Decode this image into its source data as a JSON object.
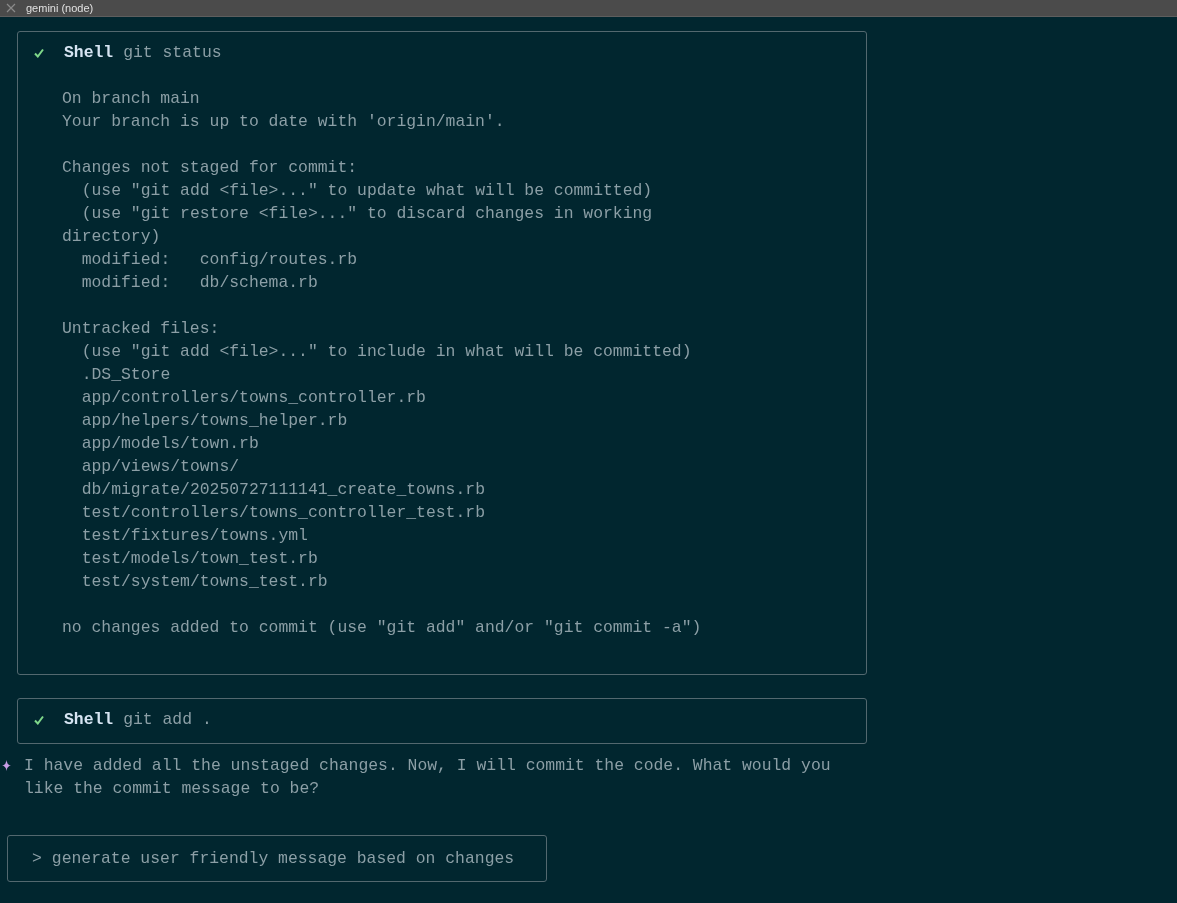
{
  "window": {
    "title": "gemini (node)"
  },
  "tool_calls": [
    {
      "completed": true,
      "tool": "Shell",
      "command": "git status",
      "output": [
        [
          "On branch main",
          "Your branch is up to date with 'origin/main'."
        ],
        [
          "Changes not staged for commit:",
          "  (use \"git add <file>...\" to update what will be committed)",
          "  (use \"git restore <file>...\" to discard changes in working directory)",
          "  modified:   config/routes.rb",
          "  modified:   db/schema.rb"
        ],
        [
          "Untracked files:",
          "  (use \"git add <file>...\" to include in what will be committed)",
          "  .DS_Store",
          "  app/controllers/towns_controller.rb",
          "  app/helpers/towns_helper.rb",
          "  app/models/town.rb",
          "  app/views/towns/",
          "  db/migrate/20250727111141_create_towns.rb",
          "  test/controllers/towns_controller_test.rb",
          "  test/fixtures/towns.yml",
          "  test/models/town_test.rb",
          "  test/system/towns_test.rb"
        ],
        [
          "no changes added to commit (use \"git add\" and/or \"git commit -a\")"
        ]
      ]
    },
    {
      "completed": true,
      "tool": "Shell",
      "command": "git add ."
    }
  ],
  "assistant_message": "I have added all the unstaged changes. Now, I will commit the code. What would you like the commit message to be?",
  "input": {
    "prompt": ">",
    "value": "generate user friendly message based on changes"
  }
}
